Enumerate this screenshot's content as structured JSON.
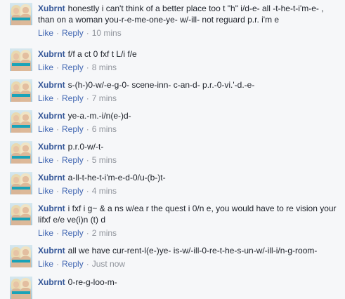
{
  "actions": {
    "like": "Like",
    "reply": "Reply",
    "separator": "·"
  },
  "comments": [
    {
      "author": "Xubrnt",
      "lines": [
        "honestly i can't think of a better place too t \"h\" i/d-e- all -t-he-t-i'm-e- ,",
        "than on a woman you-r-e-me-one-ye- w/-ill- not reguard p.r. i'm e"
      ],
      "time": "10 mins"
    },
    {
      "author": "Xubrnt",
      "lines": [
        "f/f a ct 0 fxf t L/i f/e"
      ],
      "time": "8 mins"
    },
    {
      "author": "Xubrnt",
      "lines": [
        "s-(h-)0-w/-e-g-0- scene-inn- c-an-d- p.r.-0-vi.'-d.-e-"
      ],
      "time": "7 mins"
    },
    {
      "author": "Xubrnt",
      "lines": [
        "ye-a.-m.-i/n(e-)d-"
      ],
      "time": "6 mins"
    },
    {
      "author": "Xubrnt",
      "lines": [
        "p.r.0-w/-t-"
      ],
      "time": "5 mins"
    },
    {
      "author": "Xubrnt",
      "lines": [
        "a-ll-t-he-t-i'm-e-d-0/u-(b-)t-"
      ],
      "time": "4 mins"
    },
    {
      "author": "Xubrnt",
      "lines": [
        "i fxf i g~ & a ns w/ea r the quest i 0/n e, you would have to re vision your",
        "lifxf e/e ve(i)n (t) d"
      ],
      "time": "2 mins"
    },
    {
      "author": "Xubrnt",
      "lines": [
        "all we have cur-rent-l(e-)ye- is-w/-ill-0-re-t-he-s-un-w/-ill-i/n-g-room-"
      ],
      "time": "Just now"
    },
    {
      "author": "Xubrnt",
      "lines": [
        "0-re-g-loo-m-"
      ],
      "time": ""
    }
  ]
}
